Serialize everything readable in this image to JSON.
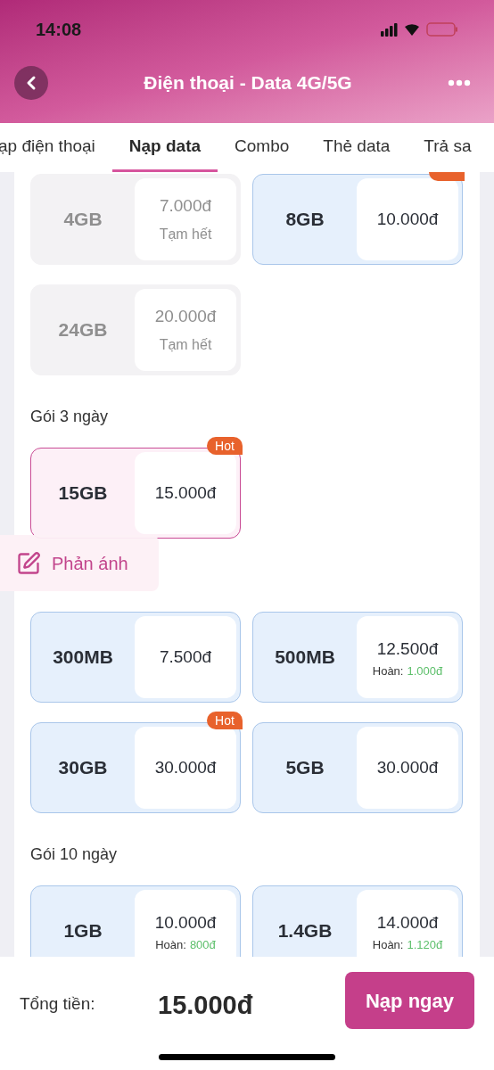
{
  "status_bar": {
    "time": "14:08"
  },
  "header": {
    "title": "Điện thoại - Data 4G/5G"
  },
  "tabs": [
    {
      "label": "ạp điện thoại",
      "selected": false
    },
    {
      "label": "Nạp data",
      "selected": true
    },
    {
      "label": "Combo",
      "selected": false
    },
    {
      "label": "Thẻ data",
      "selected": false
    },
    {
      "label": "Trả sa",
      "selected": false
    }
  ],
  "sections": [
    {
      "cards": [
        {
          "size": "4GB",
          "price": "7.000đ",
          "note": "Tạm hết",
          "sold_out": true,
          "hot": false,
          "selected": false
        },
        {
          "size": "8GB",
          "price": "10.000đ",
          "sold_out": false,
          "hot": true,
          "selected": false
        },
        {
          "size": "24GB",
          "price": "20.000đ",
          "note": "Tạm hết",
          "sold_out": true,
          "hot": false,
          "selected": false
        }
      ]
    },
    {
      "title": "Gói 3 ngày",
      "cards": [
        {
          "size": "15GB",
          "price": "15.000đ",
          "sold_out": false,
          "hot": true,
          "hot_label": "Hot",
          "selected": true
        }
      ]
    },
    {
      "cards": [
        {
          "size": "300MB",
          "price": "7.500đ",
          "sold_out": false,
          "hot": false,
          "selected": false
        },
        {
          "size": "500MB",
          "price": "12.500đ",
          "refund_label": "Hoàn:",
          "refund": "1.000đ",
          "sold_out": false,
          "hot": false,
          "selected": false
        },
        {
          "size": "30GB",
          "price": "30.000đ",
          "sold_out": false,
          "hot": true,
          "hot_label": "Hot",
          "selected": false
        },
        {
          "size": "5GB",
          "price": "30.000đ",
          "sold_out": false,
          "hot": false,
          "selected": false
        }
      ]
    },
    {
      "title": "Gói 10 ngày",
      "cards": [
        {
          "size": "1GB",
          "price": "10.000đ",
          "refund_label": "Hoàn:",
          "refund": "800đ",
          "sold_out": false,
          "hot": false,
          "selected": false
        },
        {
          "size": "1.4GB",
          "price": "14.000đ",
          "refund_label": "Hoàn:",
          "refund": "1.120đ",
          "sold_out": false,
          "hot": false,
          "selected": false
        }
      ]
    }
  ],
  "feedback": {
    "label": "Phản ánh"
  },
  "footer": {
    "total_label": "Tổng tiền:",
    "total": "15.000đ",
    "button": "Nạp ngay"
  }
}
